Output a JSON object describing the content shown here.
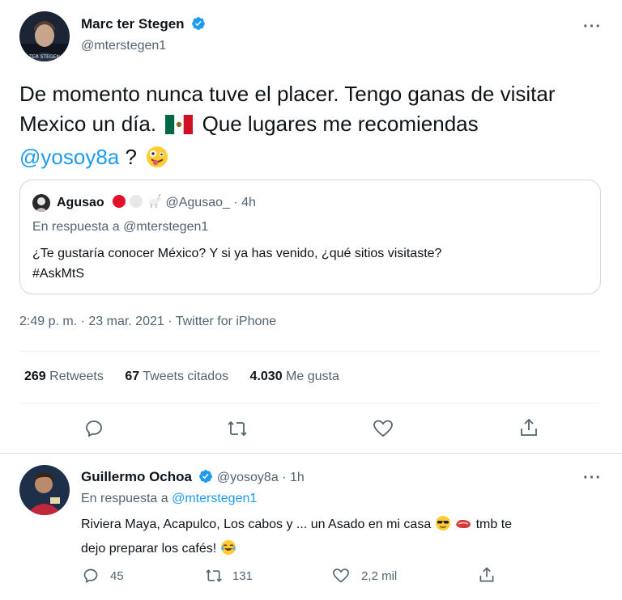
{
  "main_tweet": {
    "author_name": "Marc ter Stegen",
    "author_handle": "@mterstegen1",
    "more_glyph": "···",
    "text_line1": "De momento nunca tuve el placer. Tengo ganas de visitar",
    "text_line2_a": "Mexico un día.",
    "text_line2_b": "Que lugares me recomiendas",
    "mention": "@yosoy8a",
    "text_after_mention": "?",
    "timestamp": "2:49 p. m. · 23 mar. 2021 · Twitter for iPhone",
    "stats": {
      "retweets_count": "269",
      "retweets_label": "Retweets",
      "quotes_count": "67",
      "quotes_label": "Tweets citados",
      "likes_count": "4.030",
      "likes_label": "Me gusta"
    }
  },
  "quoted_tweet": {
    "author_name": "Agusao",
    "author_handle": "@Agusao_",
    "time": "· 4h",
    "reply_prefix": "En respuesta a",
    "reply_to": "@mterstegen1",
    "text_line1": "¿Te gustaría conocer México? Y si ya has venido, ¿qué sitios visitaste?",
    "text_line2": "#AskMtS"
  },
  "reply_tweet": {
    "author_name": "Guillermo Ochoa",
    "author_handle": "@yosoy8a",
    "time": "· 1h",
    "more_glyph": "···",
    "reply_prefix": "En respuesta a",
    "reply_to": "@mterstegen1",
    "text_line1": "Riviera Maya, Acapulco, Los cabos y ... un Asado en mi casa",
    "text_line1_end": "tmb te",
    "text_line2": "dejo preparar los cafés!",
    "replies_count": "45",
    "retweets_count": "131",
    "likes_count": "2,2 mil"
  },
  "colors": {
    "accent": "#1d9bf0",
    "text": "#0f1419",
    "secondary": "#536471",
    "divider": "#eff3f4"
  }
}
